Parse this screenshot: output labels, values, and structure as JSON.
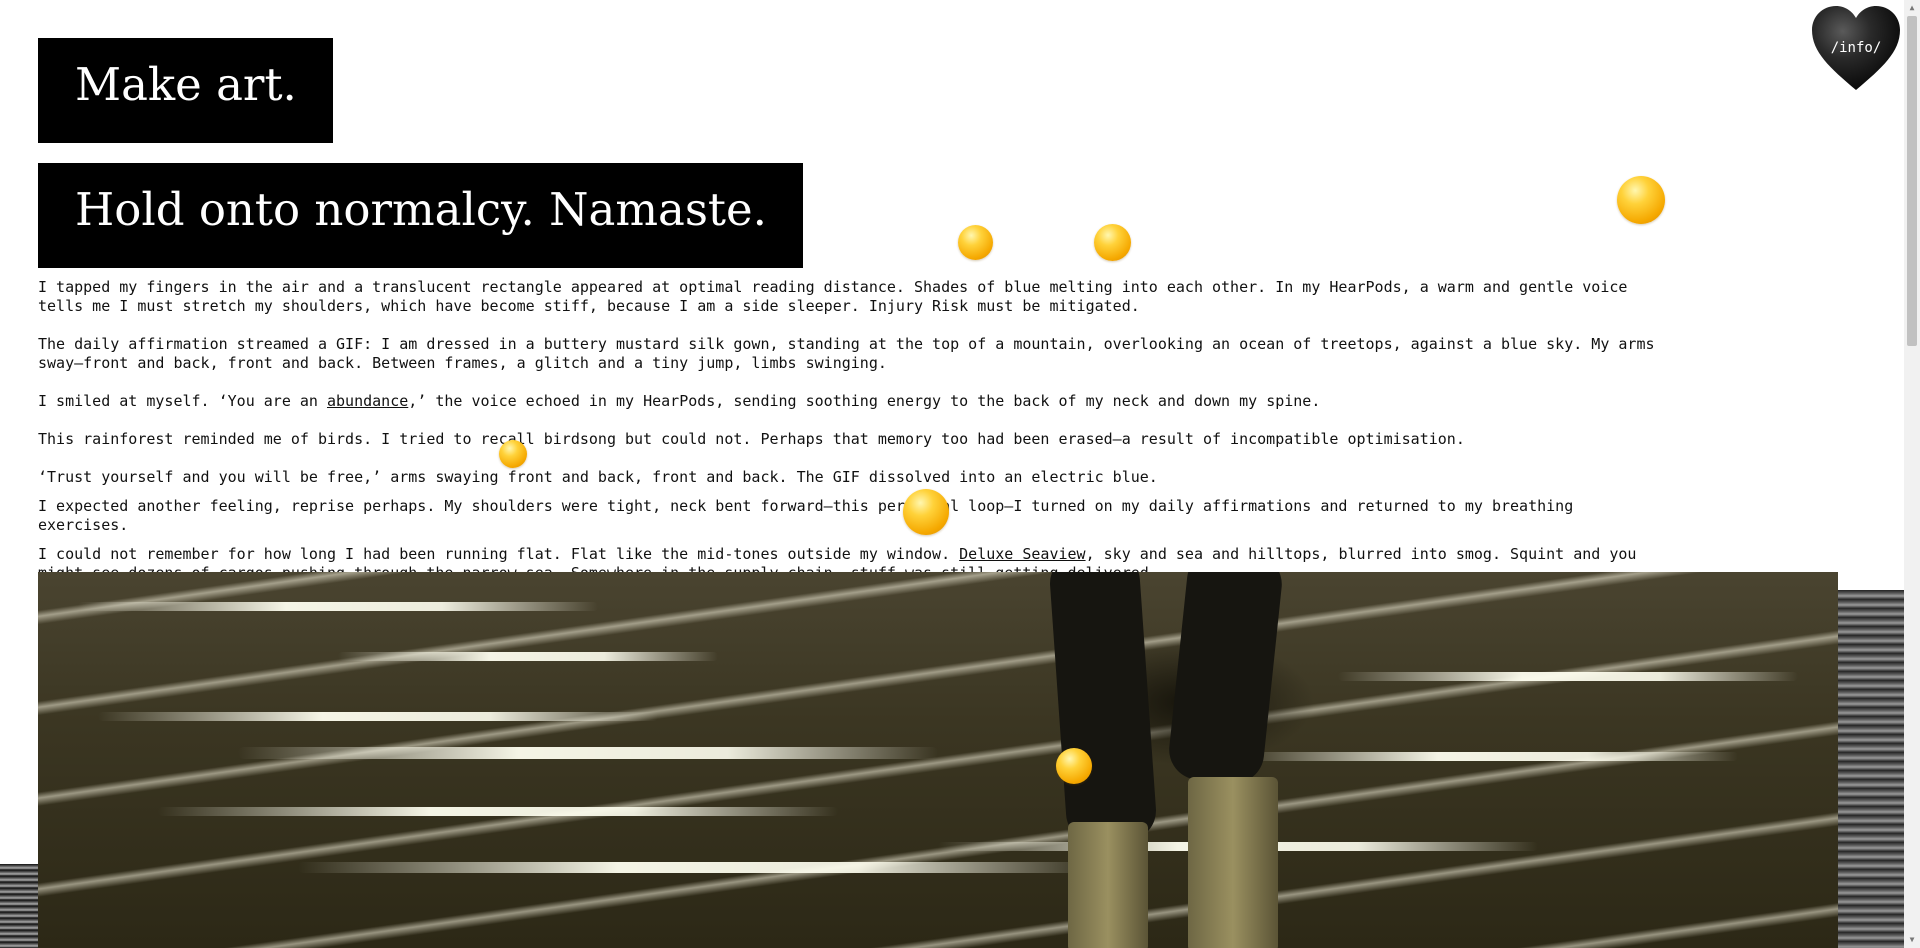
{
  "headings": {
    "line1": "Make art.",
    "line2": "Hold onto normalcy. Namaste."
  },
  "info_link": "/info/",
  "story": {
    "p1": "I tapped my fingers in the air and a translucent rectangle appeared at optimal reading distance. Shades of blue melting into each other. In my HearPods, a warm and gentle voice tells me I must stretch my shoulders, which have become stiff, because I am a side sleeper. Injury Risk must be mitigated.",
    "p2": "The daily affirmation streamed a GIF: I am dressed in a buttery mustard silk gown, standing at the top of a mountain, overlooking an ocean of treetops, against a blue sky. My arms sway—front and back, front and back. Between frames, a glitch and a tiny jump, limbs swinging.",
    "p3_before": "I smiled at myself. ‘You are an ",
    "p3_link": "abundance",
    "p3_after": ",’ the voice echoed in my HearPods, sending soothing energy to the back of my neck and down my spine.",
    "p4": "This rainforest reminded me of birds. I tried to recall birdsong but could not. Perhaps that memory too had been erased—a result of incompatible optimisation.",
    "p5": "‘Trust yourself and you will be free,’ arms swaying front and back, front and back. The GIF dissolved into an electric blue.",
    "p6": "I expected another feeling, reprise perhaps. My shoulders were tight, neck bent forward—this perpetual loop—I turned on my daily affirmations and returned to my breathing exercises.",
    "p7_before": "I could not remember for how long I had been running flat. Flat like the mid-tones outside my window. ",
    "p7_link": "Deluxe Seaview",
    "p7_after": ", sky and sea and hilltops, blurred into smog. Squint and you might see dozens of cargos pushing through the narrow sea. Somewhere in the supply chain, stuff was still getting delivered."
  },
  "colors": {
    "heading_bg": "#000000",
    "heading_text": "#ffffff",
    "orb": "#ffc21a",
    "heart": "#1a1a1a"
  },
  "icons": [
    "heart-icon",
    "sun-orb-icon"
  ]
}
